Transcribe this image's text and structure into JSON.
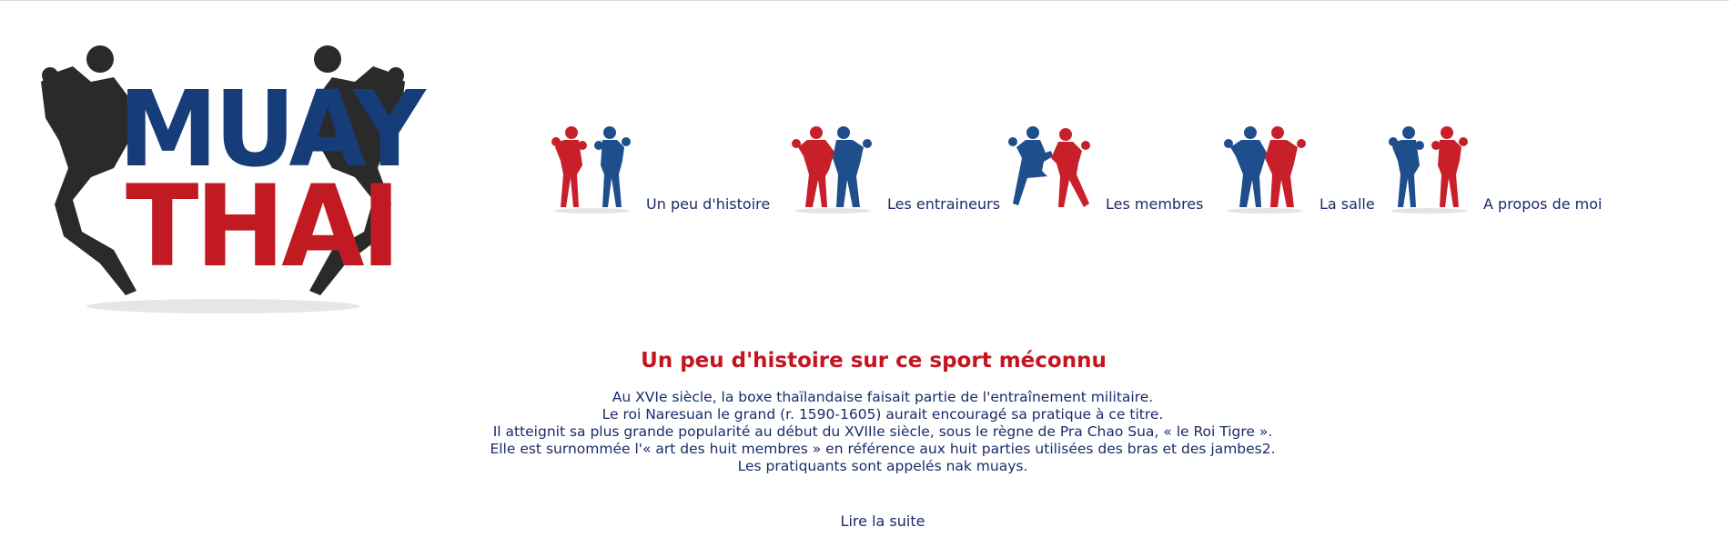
{
  "logo": {
    "line1": "MUAY",
    "line2": "THAI",
    "colors": {
      "blue": "#163c7a",
      "red": "#c21a22",
      "dark": "#2a2a2a"
    }
  },
  "nav": {
    "items": [
      {
        "label": "Un peu d'histoire",
        "icon": "boxers-red-blue-icon"
      },
      {
        "label": "Les entraineurs",
        "icon": "boxers-clinch-icon"
      },
      {
        "label": "Les membres",
        "icon": "boxers-kick-icon"
      },
      {
        "label": "La salle",
        "icon": "boxers-clinch-2-icon"
      },
      {
        "label": "A propos de moi",
        "icon": "boxers-blue-red-icon"
      }
    ]
  },
  "content": {
    "title": "Un peu d'histoire sur ce sport méconnu",
    "lines": [
      "Au XVIe siècle, la boxe thaïlandaise faisait partie de l'entraînement militaire.",
      "Le roi Naresuan le grand (r. 1590-1605) aurait encouragé sa pratique à ce titre.",
      "Il atteignit sa plus grande popularité au début du XVIIIe siècle, sous le règne de Pra Chao Sua, « le Roi Tigre ».",
      "Elle est surnommée l'« art des huit membres » en référence aux huit parties utilisées des bras et des jambes2.",
      "Les pratiquants sont appelés nak muays."
    ],
    "read_more": "Lire la suite"
  },
  "colors": {
    "title_red": "#c41420",
    "text_navy": "#1b2a6b",
    "fighter_red": "#c8202a",
    "fighter_blue": "#1f4e8c"
  }
}
